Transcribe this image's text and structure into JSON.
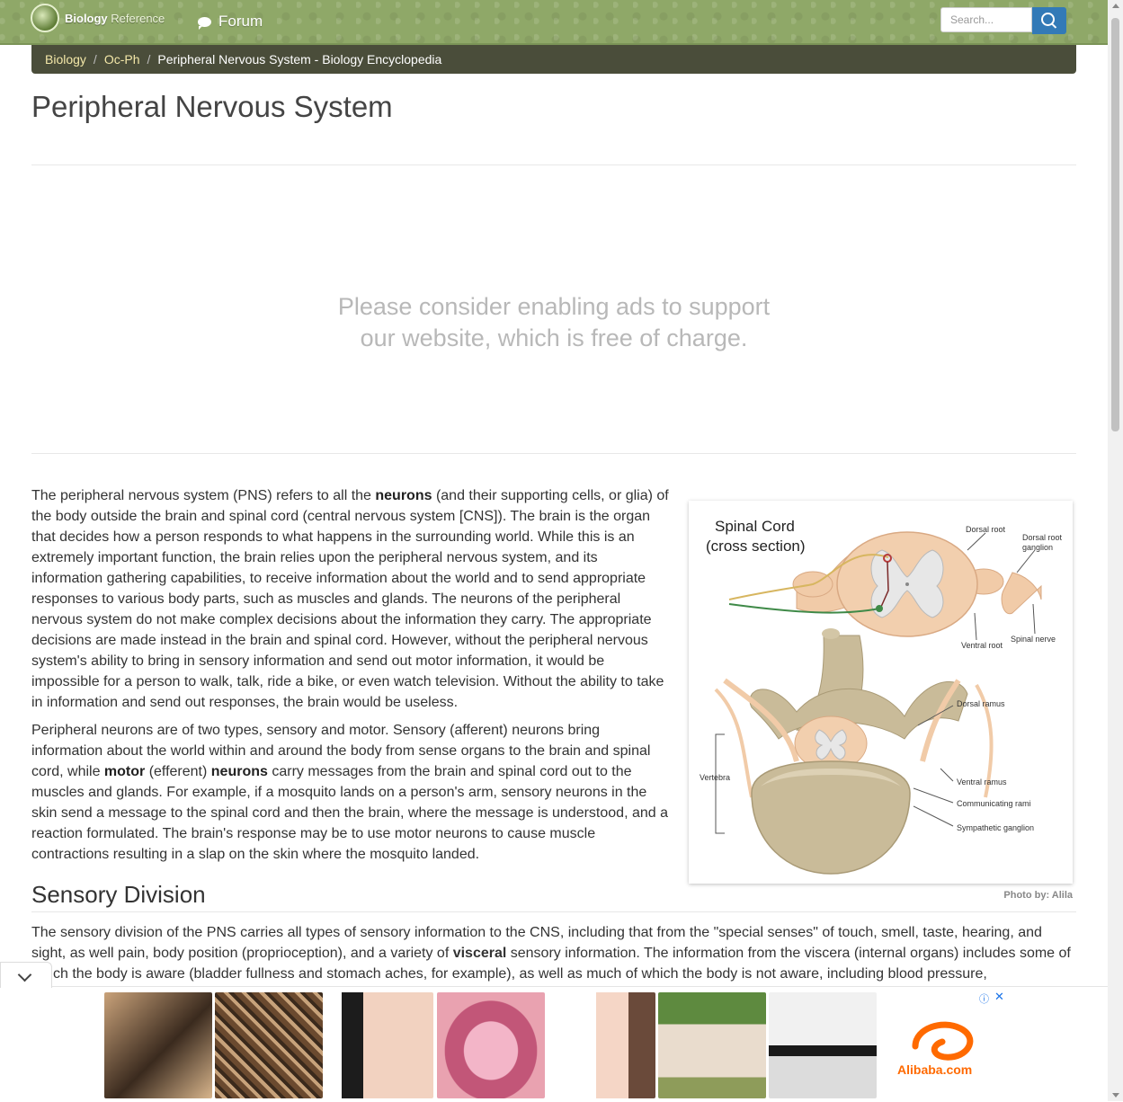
{
  "nav": {
    "brand_bold": "Biology",
    "brand_light": "Reference",
    "forum_label": "Forum",
    "search_placeholder": "Search..."
  },
  "breadcrumb": {
    "items": [
      "Biology",
      "Oc-Ph"
    ],
    "current": "Peripheral Nervous System - Biology Encyclopedia"
  },
  "page_title": "Peripheral Nervous System",
  "ad_message": {
    "line1": "Please consider enabling ads to support",
    "line2": "our website, which is free of charge."
  },
  "article": {
    "p1": {
      "a": "The peripheral nervous system (PNS) refers to all the ",
      "b": "neurons",
      "c": " (and their supporting cells, or glia) of the body outside the brain and spinal cord (central nervous system [CNS]). The brain is the organ that decides how a person responds to what happens in the surrounding world. While this is an extremely important function, the brain relies upon the peripheral nervous system, and its information gathering capabilities, to receive information about the world and to send appropriate responses to various body parts, such as muscles and glands. The neurons of the peripheral nervous system do not make complex decisions about the information they carry. The appropriate decisions are made instead in the brain and spinal cord. However, without the peripheral nervous system's ability to bring in sensory information and send out motor information, it would be impossible for a person to walk, talk, ride a bike, or even watch television. Without the ability to take in information and send out responses, the brain would be useless."
    },
    "p2": {
      "a": "Peripheral neurons are of two types, sensory and motor. Sensory (afferent) neurons bring information about the world within and around the body from sense organs to the brain and spinal cord, while ",
      "b": "motor",
      "c": " (efferent) ",
      "d": "neurons",
      "e": " carry messages from the brain and spinal cord out to the muscles and glands. For example, if a mosquito lands on a person's arm, sensory neurons in the skin send a message to the spinal cord and then the brain, where the message is understood, and a reaction formulated. The brain's response may be to use motor neurons to cause muscle contractions resulting in a slap on the skin where the mosquito landed."
    },
    "section_title": "Sensory Division",
    "p3": {
      "a": "The sensory division of the PNS carries all types of sensory information to the CNS, including that from the \"special senses\" of touch, smell, taste, hearing, and sight, as well pain, body position (proprioception), and a variety of ",
      "b": "visceral",
      "c": " sensory information. The information from the viscera (internal organs) includes some of which the body is aware (bladder fullness and stomach aches, for example), as well as much of which the body is not aware, including blood pressure,"
    }
  },
  "figure": {
    "title_line1": "Spinal Cord",
    "title_line2": "(cross section)",
    "labels": {
      "dorsal_root": "Dorsal root",
      "dorsal_root_ganglion_1": "Dorsal root",
      "dorsal_root_ganglion_2": "ganglion",
      "ventral_root": "Ventral root",
      "spinal_nerve": "Spinal nerve",
      "dorsal_ramus": "Dorsal ramus",
      "vertebra": "Vertebra",
      "ventral_ramus": "Ventral ramus",
      "communicating_rami": "Communicating rami",
      "sympathetic_ganglion": "Sympathetic ganglion"
    },
    "credit": "Photo by: Alila"
  },
  "ad_bar": {
    "alibaba": "Alibaba.com",
    "info_icon": "ⓘ",
    "close_icon": "✕"
  }
}
